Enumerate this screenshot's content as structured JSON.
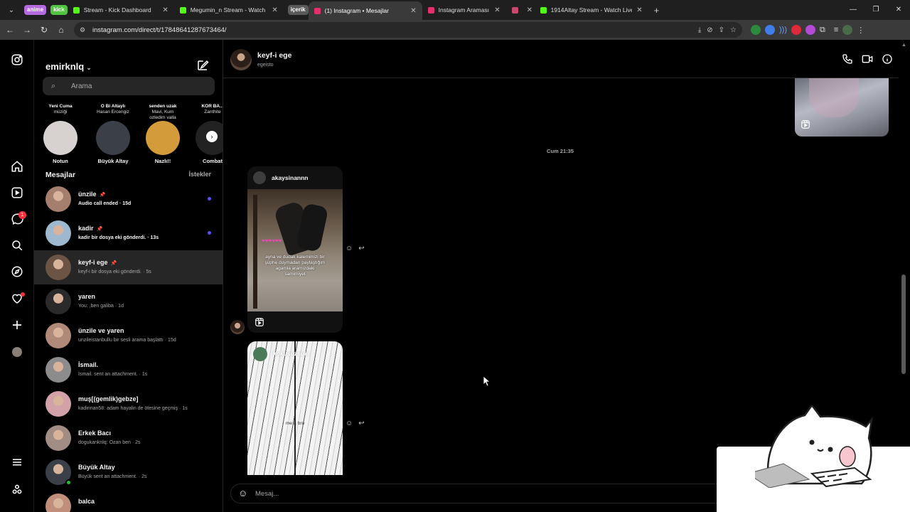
{
  "browser": {
    "groups": [
      {
        "label": "anime",
        "color": "#b56be0"
      },
      {
        "label": "kick",
        "color": "#53c441"
      },
      {
        "label": "içerik",
        "color": "#5a5a5a"
      }
    ],
    "tabs": [
      {
        "title": "Stream - Kick Dashboard",
        "favcolor": "#53fc18",
        "active": false
      },
      {
        "title": "Megumin_n Stream - Watch Li...",
        "favcolor": "#53fc18",
        "active": false
      },
      {
        "title": "(1) Instagram • Mesajlar",
        "favcolor": "#e1306c",
        "active": true
      },
      {
        "title": "Instagram Araması",
        "favcolor": "#e1306c",
        "active": false
      },
      {
        "title": "",
        "favcolor": "#c8486e",
        "active": false
      },
      {
        "title": "1914Altay Stream - Watch Live",
        "favcolor": "#53fc18",
        "active": false
      }
    ],
    "url": "instagram.com/direct/t/17848641287673464/"
  },
  "account": {
    "username": "emirknlq"
  },
  "search": {
    "placeholder": "Arama"
  },
  "notes": [
    {
      "bubble_title": "Yeni Cuma",
      "bubble_sub": "müziği",
      "name": "Notun",
      "avatar": "#d7d2cf"
    },
    {
      "bubble_title": "O Bi Altaylı",
      "bubble_sub": "Hasan Ercengiz",
      "name": "Büyük Altay",
      "avatar": "#3b3f48"
    },
    {
      "bubble_title": "senden uzak",
      "bubble_sub": "Mavi, Kum\nozledim valla",
      "name": "Nazlı!!",
      "avatar": "#d39b3a"
    },
    {
      "bubble_title": "KÖR BA...",
      "bubble_sub": "Zanthite",
      "name": "Combat",
      "avatar": "#222"
    }
  ],
  "section": {
    "messages": "Mesajlar",
    "requests": "İstekler"
  },
  "conversations": [
    {
      "name": "ünzile",
      "pinned": true,
      "preview": "Audio call ended · 15d",
      "unread": true,
      "avatar": "#a57f6e"
    },
    {
      "name": "kadir",
      "pinned": true,
      "preview": "kadir bir dosya eki gönderdi. · 13s",
      "unread": true,
      "avatar": "#9db8cf"
    },
    {
      "name": "keyf-i ege",
      "pinned": true,
      "preview": "keyf-i bir dosya eki gönderdi. · 5s",
      "unread": false,
      "selected": true,
      "avatar": "#6b5443"
    },
    {
      "name": "yaren",
      "pinned": false,
      "preview": "You: ,ben galiba · 1d",
      "unread": false,
      "avatar": "#2a2a2a"
    },
    {
      "name": "ünzile ve yaren",
      "pinned": false,
      "preview": "unzileistanbullu bir sesli arama başlattı · 15d",
      "unread": false,
      "avatar": "#b08a79"
    },
    {
      "name": "İsmail.",
      "pinned": false,
      "preview": "İsmail. sent an attachment. · 1s",
      "unread": false,
      "avatar": "#8c8c8c"
    },
    {
      "name": "muş[(gemlik)gebze]",
      "pinned": false,
      "preview": "kadirinan58: adam hayalin de ötesine geçmiş · 1s",
      "unread": false,
      "avatar": "#d2a2a8"
    },
    {
      "name": "Erkek Bacı",
      "pinned": false,
      "preview": "dogukanknlq: Ozan ben · 2s",
      "unread": false,
      "avatar": "#a18d84"
    },
    {
      "name": "Büyük Altay",
      "pinned": false,
      "preview": "Büyük sent an attachment. · 2s",
      "unread": false,
      "online": true,
      "avatar": "#3b3f48"
    },
    {
      "name": "balca",
      "pinned": false,
      "preview": "",
      "unread": false,
      "avatar": "#c08e7a"
    }
  ],
  "chat": {
    "name": "keyf-i ege",
    "username": "egeisto",
    "time_separator": "Cum 21:35",
    "shares": [
      {
        "user": "akaysinannn",
        "caption": "ayna ve dudak kalemimizi bir\nşüphe duymadan paylaştığım\nagamla aramızdaki\nsamimiyet"
      },
      {
        "user": "kokusuzsuki",
        "caption": "me & bro"
      }
    ],
    "composer_placeholder": "Mesaj..."
  }
}
